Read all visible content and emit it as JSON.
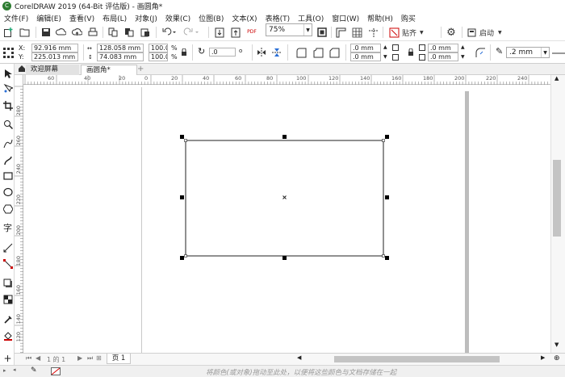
{
  "window": {
    "title": "CorelDRAW 2019 (64-Bit 评估版) - 画圆角*",
    "logo_glyph": "C"
  },
  "menu": [
    {
      "label": "文件(F)"
    },
    {
      "label": "编辑(E)"
    },
    {
      "label": "查看(V)"
    },
    {
      "label": "布局(L)"
    },
    {
      "label": "对象(J)"
    },
    {
      "label": "效果(C)"
    },
    {
      "label": "位图(B)"
    },
    {
      "label": "文本(X)"
    },
    {
      "label": "表格(T)"
    },
    {
      "label": "工具(O)"
    },
    {
      "label": "窗口(W)"
    },
    {
      "label": "帮助(H)"
    },
    {
      "label": "购买"
    }
  ],
  "toolbar": {
    "zoom_value": "75%",
    "snap_label": "贴齐",
    "launch_label": "启动",
    "pdf_label": "PDF"
  },
  "propbar": {
    "x_label": "X:",
    "x_value": "92.916 mm",
    "y_label": "Y:",
    "y_value": "225.013 mm",
    "w_value": "128.058 mm",
    "h_value": "74.083 mm",
    "sx_value": "100.0",
    "sy_value": "100.0",
    "percent": "%",
    "rotation_value": ".0",
    "corner_tl": ".0 mm",
    "corner_bl": ".0 mm",
    "corner_tr": ".0 mm",
    "corner_br": ".0 mm",
    "outline_value": ".2 mm"
  },
  "doctabs": {
    "welcome": "欢迎屏幕",
    "document": "画圆角*",
    "add": "+"
  },
  "ruler": {
    "h_ticks": [
      "60",
      "40",
      "20",
      "0",
      "20",
      "40",
      "60",
      "80",
      "100",
      "120",
      "140",
      "160",
      "180",
      "200",
      "220",
      "240"
    ],
    "v_ticks": [
      "280",
      "260",
      "240",
      "220",
      "200",
      "180",
      "160",
      "140",
      "120",
      "100"
    ]
  },
  "pagenav": {
    "page_of": "1 的 1",
    "page_tab": "页 1"
  },
  "status": {
    "hint": "将颜色(或对象)拖动至此处，以便将这些颜色与文档存储在一起"
  },
  "colors": {
    "selection": "#000000",
    "page_shadow": "#bdbdbd",
    "logo_green": "#2e7d32"
  }
}
